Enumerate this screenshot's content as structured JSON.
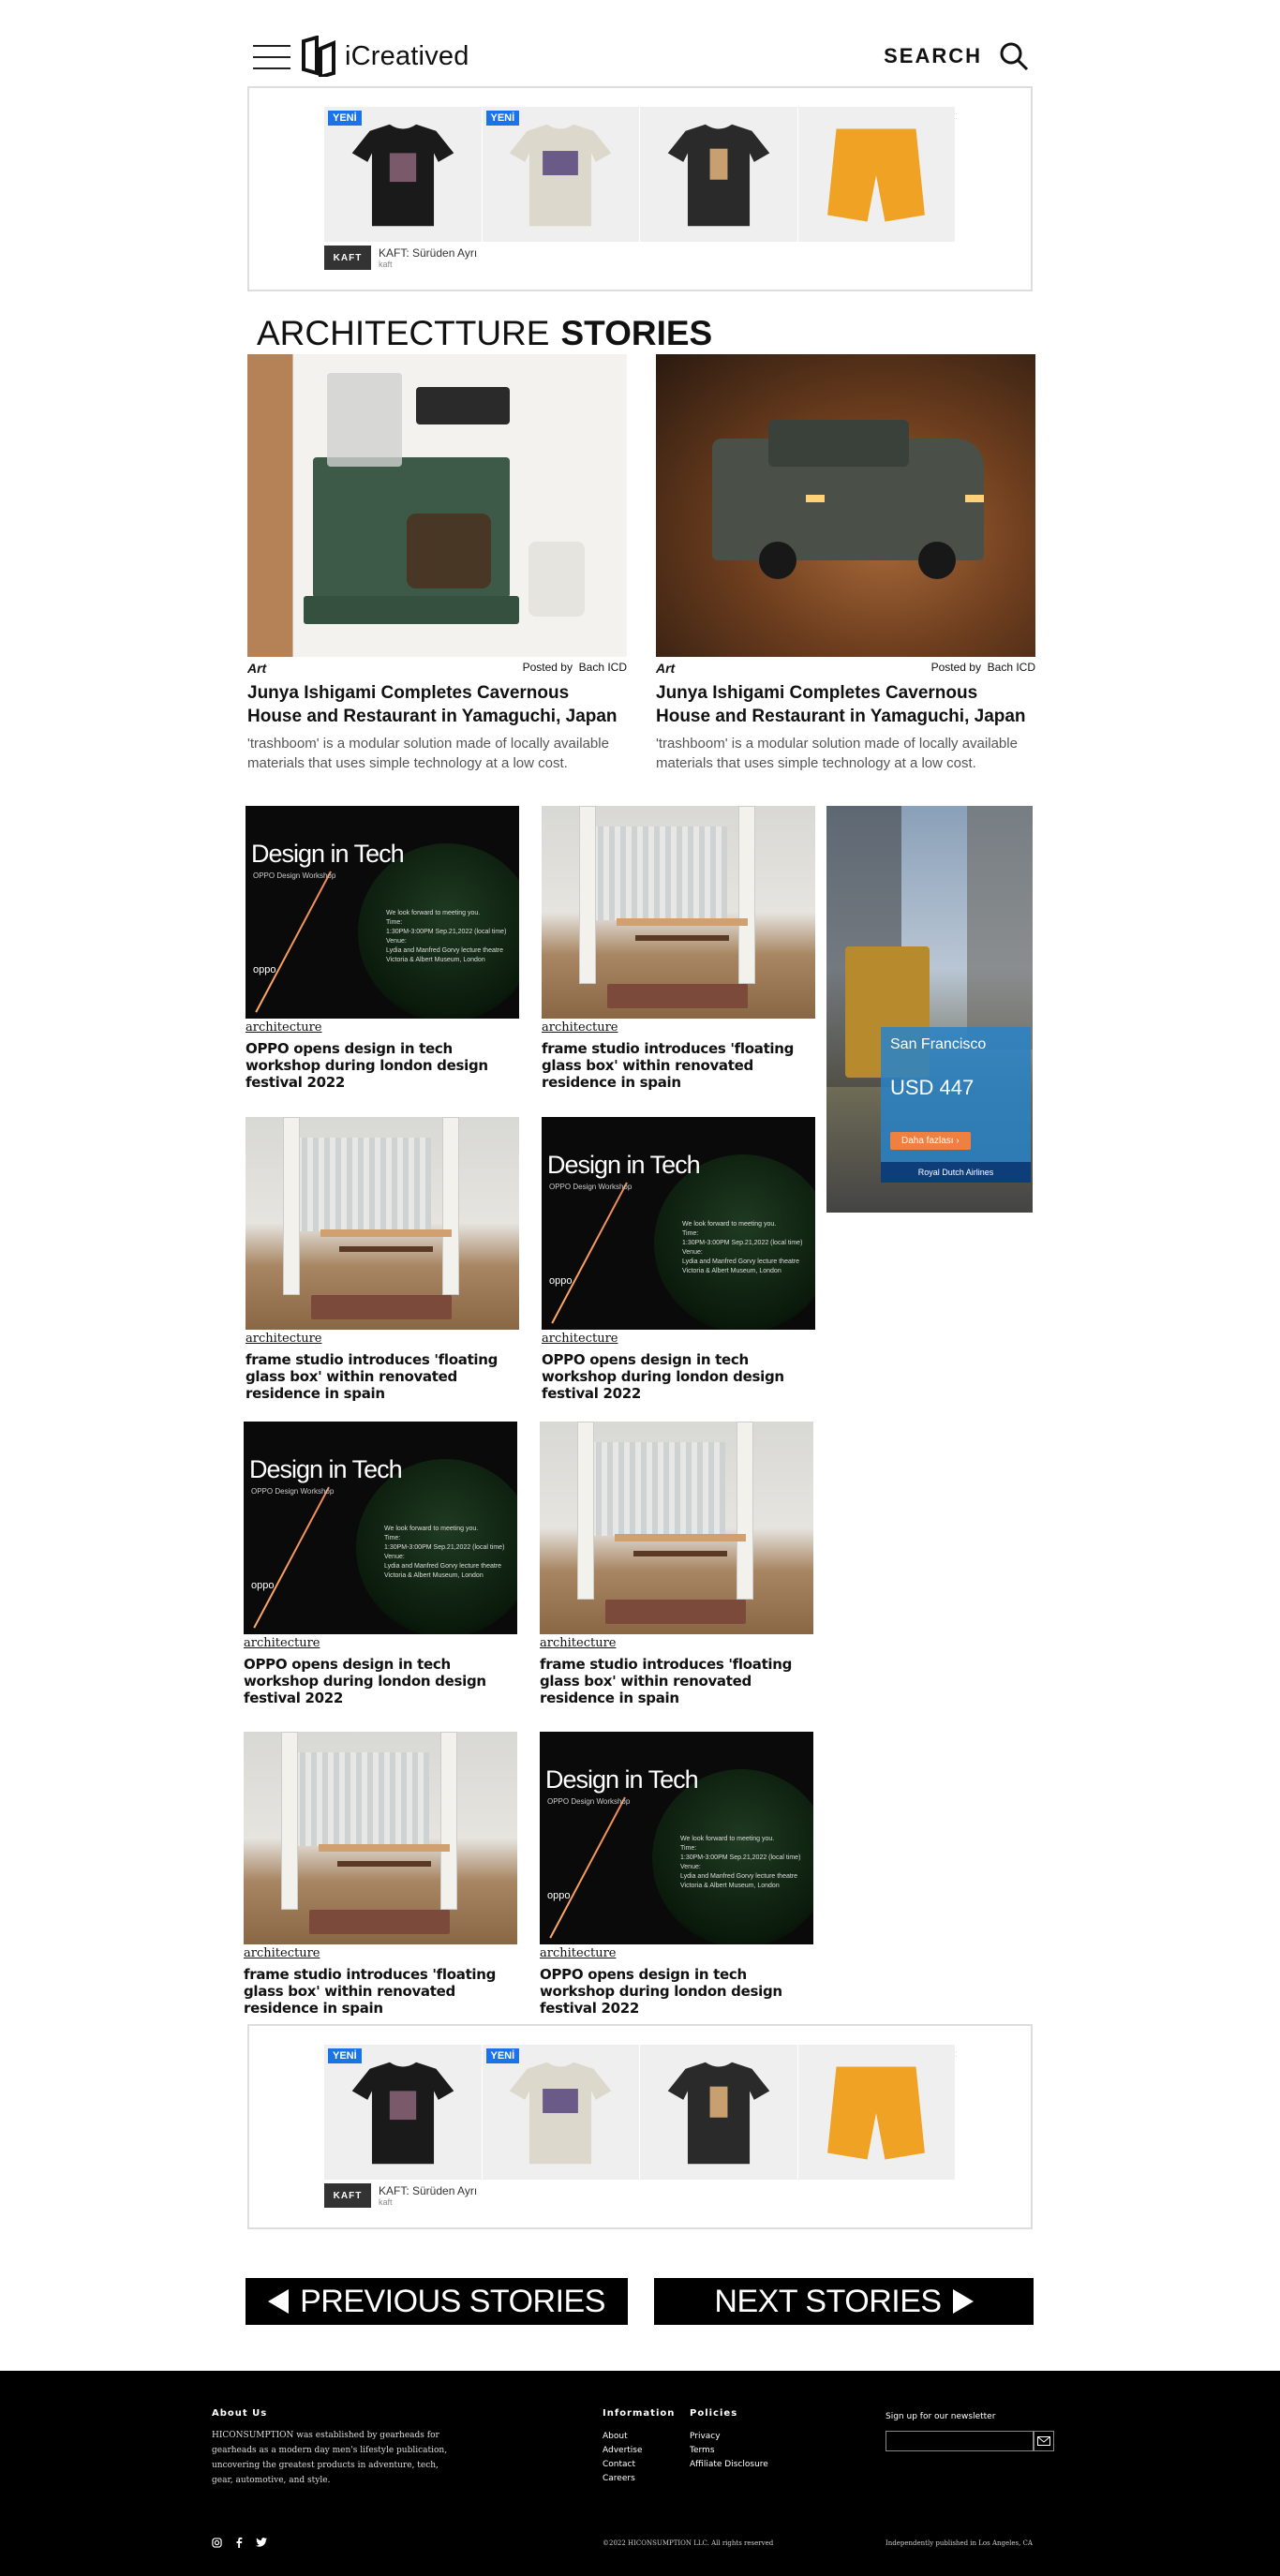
{
  "header": {
    "logo_text": "iCreatived",
    "search_label": "SEARCH"
  },
  "ad_banner": {
    "badge": "YENİ",
    "brand_logo": "KAFT",
    "title": "KAFT: Sürüden Ayrı",
    "sub": "kaft",
    "adchoices": "ⓘ ✕"
  },
  "section": {
    "title_light": "ARCHITECTTURE",
    "title_bold": "STORIES"
  },
  "featured": [
    {
      "category": "Art",
      "posted_by": "Posted by",
      "author": "Bach ICD",
      "title": "Junya Ishigami Completes Cavernous House and Restaurant in Yamaguchi, Japan",
      "desc": "'trashboom' is a modular solution made of locally available materials that uses simple technology at a low cost."
    },
    {
      "category": "Art",
      "posted_by": "Posted by",
      "author": "Bach ICD",
      "title": "Junya Ishigami Completes Cavernous House and Restaurant in Yamaguchi, Japan",
      "desc": "'trashboom' is a modular solution made of locally available materials that uses simple technology at a low cost."
    }
  ],
  "cards": [
    {
      "category": "architecture",
      "title": "OPPO opens design in tech workshop during london design festival 2022",
      "img": "tech"
    },
    {
      "category": "architecture",
      "title": "frame studio introduces 'floating glass box' within renovated residence in spain",
      "img": "room"
    },
    {
      "category": "architecture",
      "title": "frame studio introduces 'floating glass box' within renovated residence in spain",
      "img": "room"
    },
    {
      "category": "architecture",
      "title": "OPPO opens design in tech workshop during london design festival 2022",
      "img": "tech"
    },
    {
      "category": "architecture",
      "title": "OPPO opens design in tech workshop during london design festival 2022",
      "img": "tech"
    },
    {
      "category": "architecture",
      "title": "frame studio introduces 'floating glass box' within renovated residence in spain",
      "img": "room"
    },
    {
      "category": "architecture",
      "title": "frame studio introduces 'floating glass box' within renovated residence in spain",
      "img": "room"
    },
    {
      "category": "architecture",
      "title": "OPPO opens design in tech workshop during london design festival 2022",
      "img": "tech"
    }
  ],
  "tech_image": {
    "title": "Design in Tech",
    "sub": "OPPO Design Workshop",
    "info": "We look forward to meeting you.\nTime:\n1:30PM-3:00PM Sep.21,2022 (local time)\nVenue:\nLydia and Manfred Gorvy lecture theatre\nVictoria & Albert Museum, London",
    "brand": "oppo"
  },
  "side_ad": {
    "city": "San Francisco",
    "price": "USD 447",
    "button": "Daha fazlası ›",
    "airline": "Royal Dutch Airlines"
  },
  "pagination": {
    "prev": "PREVIOUS STORIES",
    "next": "NEXT STORIES"
  },
  "footer": {
    "about_heading": "About Us",
    "about_text": "HICONSUMPTION was established by gearheads for gearheads as a modern day men's lifestyle publication, uncovering the greatest products in adventure, tech, gear, automotive, and style.",
    "info_heading": "Information",
    "info_links": [
      "About",
      "Advertise",
      "Contact",
      "Careers"
    ],
    "policies_heading": "Policies",
    "policies_links": [
      "Privacy",
      "Terms",
      "Affiliate Disclosure"
    ],
    "newsletter_label": "Sign up for our newsletter",
    "copyright": "©2022 HICONSUMPTION LLC. All rights reserved",
    "published": "Independently published in Los Angeles, CA"
  },
  "colors": {
    "accent": "#000000",
    "ad_badge": "#1a73e8"
  }
}
